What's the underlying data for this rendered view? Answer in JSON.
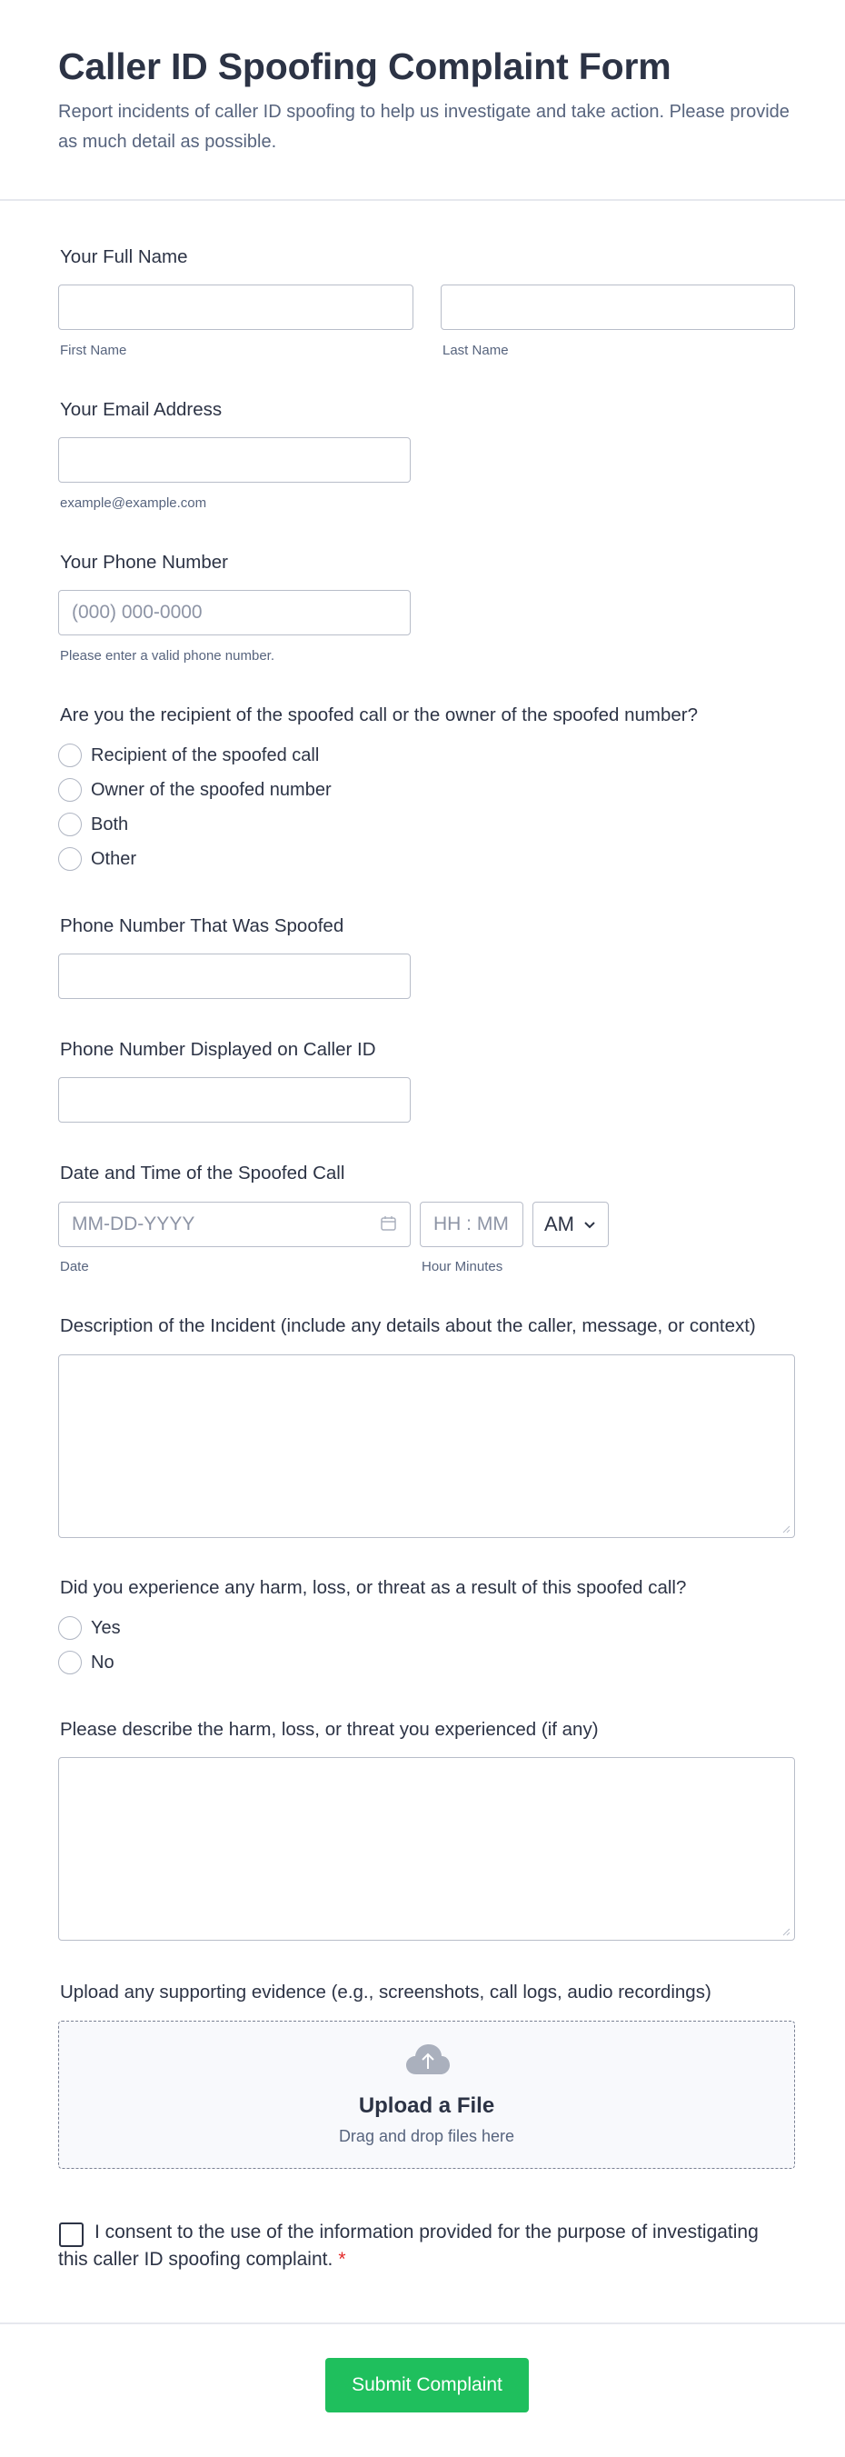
{
  "header": {
    "title": "Caller ID Spoofing Complaint Form",
    "subtitle": "Report incidents of caller ID spoofing to help us investigate and take action. Please provide as much detail as possible."
  },
  "full_name": {
    "label": "Your Full Name",
    "first_sublabel": "First Name",
    "last_sublabel": "Last Name"
  },
  "email": {
    "label": "Your Email Address",
    "sublabel": "example@example.com"
  },
  "phone": {
    "label": "Your Phone Number",
    "placeholder": "(000) 000-0000",
    "sublabel": "Please enter a valid phone number."
  },
  "role": {
    "label": "Are you the recipient of the spoofed call or the owner of the spoofed number?",
    "options": [
      "Recipient of the spoofed call",
      "Owner of the spoofed number",
      "Both",
      "Other"
    ]
  },
  "spoofed_number": {
    "label": "Phone Number That Was Spoofed"
  },
  "displayed_number": {
    "label": "Phone Number Displayed on Caller ID"
  },
  "datetime": {
    "label": "Date and Time of the Spoofed Call",
    "date_placeholder": "MM-DD-YYYY",
    "time_placeholder": "HH : MM",
    "ampm_value": "AM",
    "date_sublabel": "Date",
    "time_sublabel": "Hour Minutes"
  },
  "description": {
    "label": "Description of the Incident (include any details about the caller, message, or context)"
  },
  "harm": {
    "label": "Did you experience any harm, loss, or threat as a result of this spoofed call?",
    "options": [
      "Yes",
      "No"
    ]
  },
  "harm_details": {
    "label": "Please describe the harm, loss, or threat you experienced (if any)"
  },
  "upload": {
    "label": "Upload any supporting evidence (e.g., screenshots, call logs, audio recordings)",
    "title": "Upload a File",
    "subtitle": "Drag and drop files here"
  },
  "consent": {
    "text": "I consent to the use of the information provided for the purpose of investigating this caller ID spoofing complaint.",
    "required_mark": "*"
  },
  "submit": {
    "label": "Submit Complaint"
  },
  "colors": {
    "accent": "#1fbf5d",
    "text": "#2c3345",
    "muted": "#57647e",
    "required": "#e32929"
  }
}
